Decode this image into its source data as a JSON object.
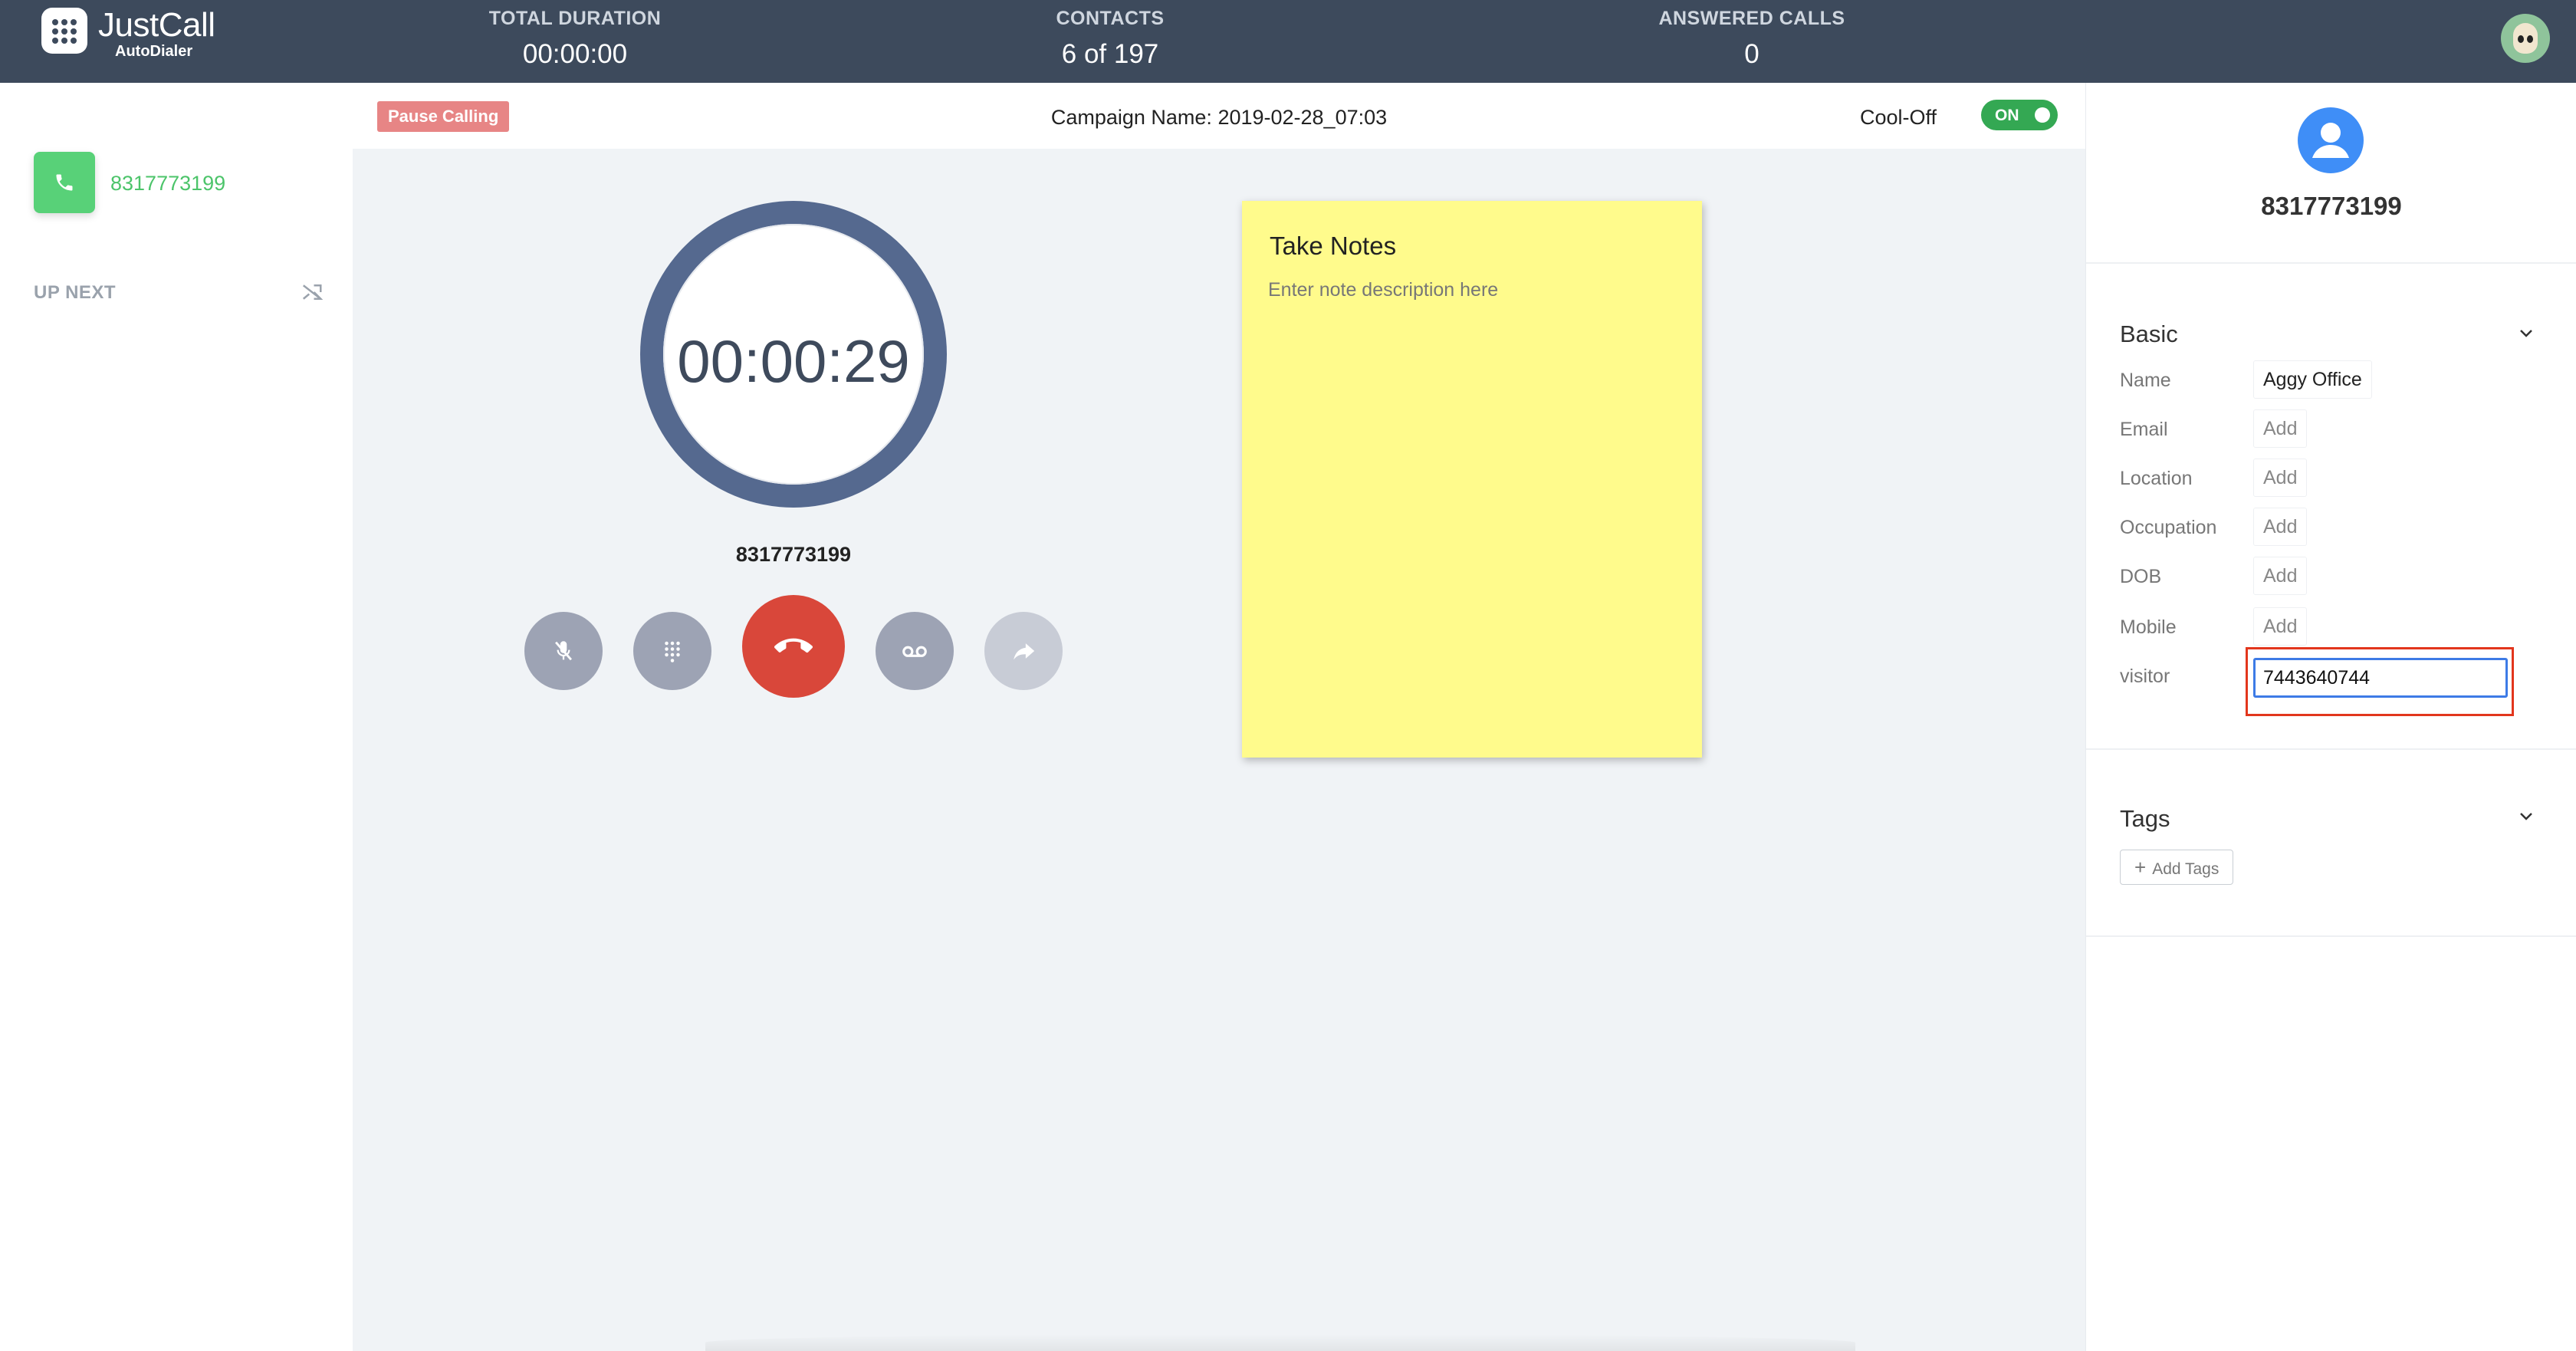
{
  "app": {
    "brand_title": "JustCall",
    "brand_subtitle": "AutoDialer"
  },
  "stats": {
    "total_duration_label": "TOTAL DURATION",
    "total_duration_value": "00:00:00",
    "contacts_label": "CONTACTS",
    "contacts_value": "6 of 197",
    "answered_label": "ANSWERED CALLS",
    "answered_value": "0"
  },
  "sidebar": {
    "current_number": "8317773199",
    "up_next_label": "UP NEXT"
  },
  "header": {
    "pause_label": "Pause Calling",
    "campaign_name": "Campaign Name: 2019-02-28_07:03",
    "cooloff_label": "Cool-Off",
    "cooloff_toggle": "ON"
  },
  "call": {
    "timer": "00:00:29",
    "number": "8317773199",
    "controls": [
      "mute-icon",
      "dialpad-icon",
      "hangup-icon",
      "voicemail-icon",
      "transfer-icon"
    ]
  },
  "notes": {
    "title": "Take Notes",
    "placeholder": "Enter note description here"
  },
  "contact": {
    "number": "8317773199",
    "basic_title": "Basic",
    "fields": [
      {
        "label": "Name",
        "value": "Aggy Office"
      },
      {
        "label": "Email",
        "value": "Add"
      },
      {
        "label": "Location",
        "value": "Add"
      },
      {
        "label": "Occupation",
        "value": "Add"
      },
      {
        "label": "DOB",
        "value": "Add"
      },
      {
        "label": "Mobile",
        "value": "Add"
      }
    ],
    "visitor_label": "visitor",
    "visitor_value": "7443640744",
    "tags_title": "Tags",
    "add_tags_label": "Add Tags"
  },
  "colors": {
    "topbar": "#3d4a5c",
    "accent_green": "#58d178",
    "hangup_red": "#d9473a",
    "timer_ring": "#55698f",
    "notes_yellow": "#fffb8c",
    "highlight_red": "#e2361d",
    "focus_blue": "#3d7be6"
  }
}
